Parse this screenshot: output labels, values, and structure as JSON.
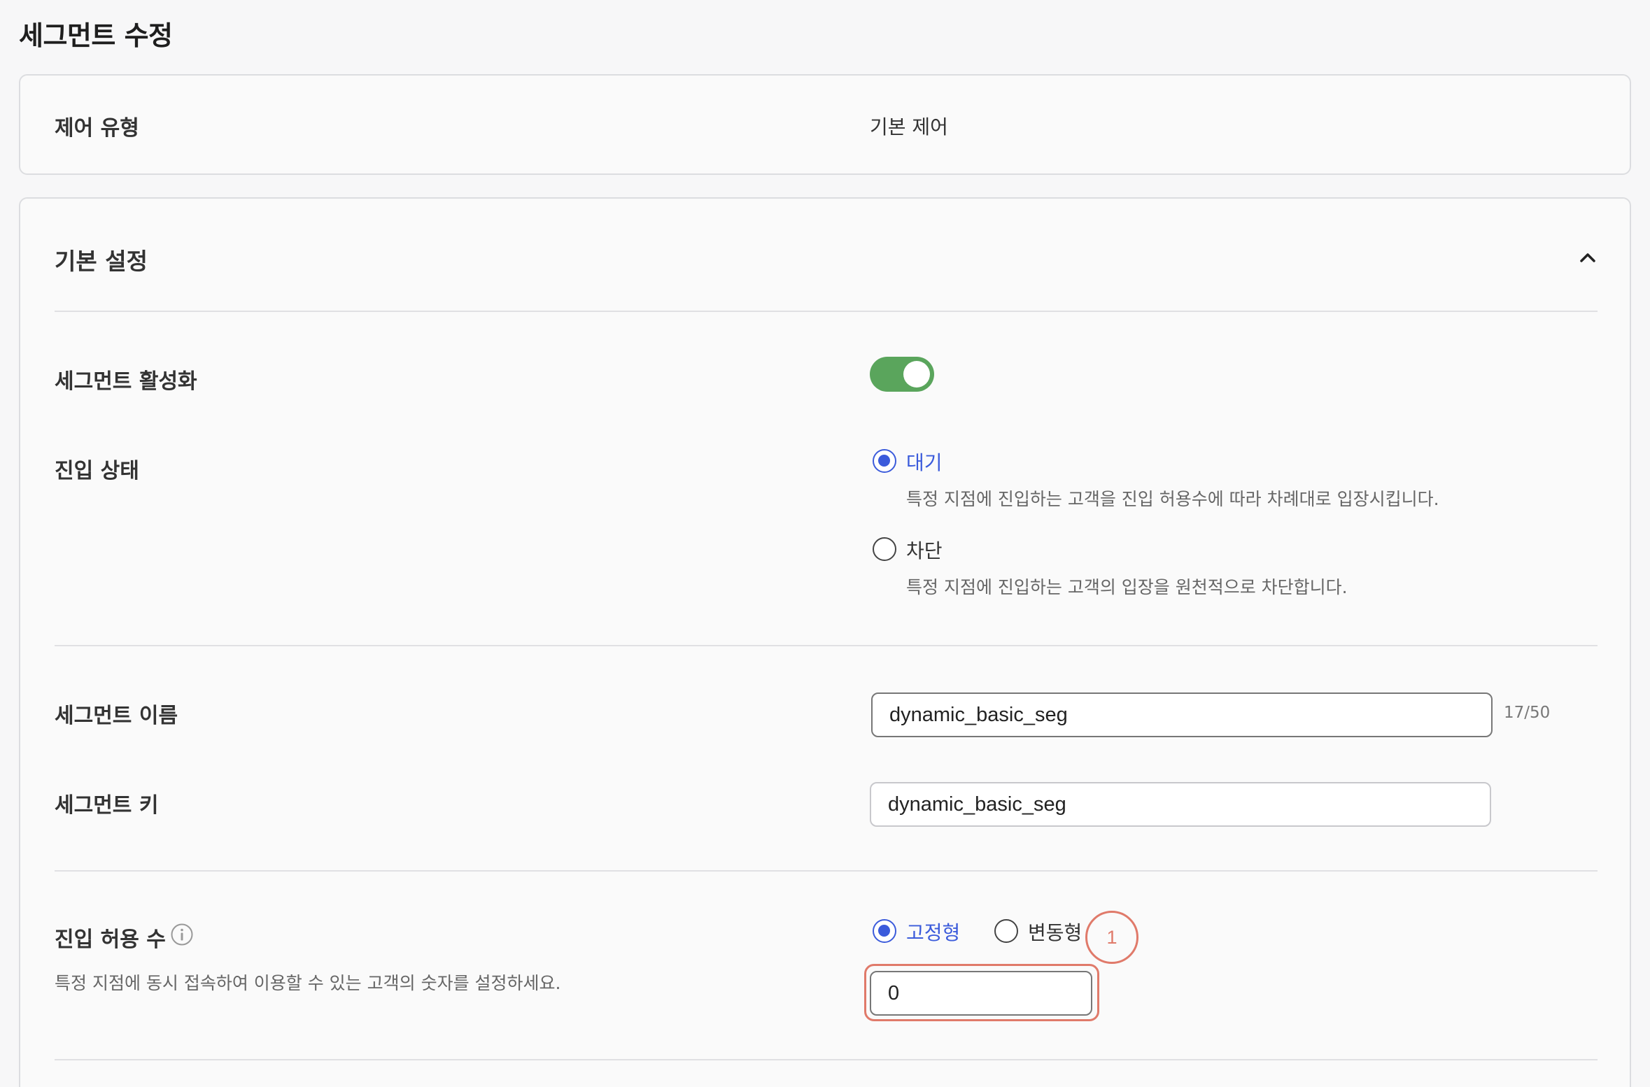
{
  "page": {
    "title": "세그먼트 수정"
  },
  "control_type": {
    "label": "제어 유형",
    "value": "기본 제어"
  },
  "basic_settings": {
    "title": "기본 설정",
    "collapse_icon": "chevron-up-icon",
    "activation": {
      "label": "세그먼트 활성화",
      "enabled": true,
      "accent_color": "#5aa55c"
    },
    "entry_status": {
      "label": "진입 상태",
      "options": [
        {
          "label": "대기",
          "desc": "특정 지점에 진입하는 고객을 진입 허용수에 따라 차례대로 입장시킵니다.",
          "selected": true
        },
        {
          "label": "차단",
          "desc": "특정 지점에 진입하는 고객의 입장을 원천적으로 차단합니다.",
          "selected": false
        }
      ]
    },
    "segment_name": {
      "label": "세그먼트 이름",
      "value": "dynamic_basic_seg",
      "counter": "17/50"
    },
    "segment_key": {
      "label": "세그먼트 키",
      "value": "dynamic_basic_seg"
    },
    "entry_limit": {
      "label": "진입 허용 수",
      "info_icon": "info-icon",
      "helper": "특정 지점에 동시 접속하여 이용할 수 있는 고객의 숫자를 설정하세요.",
      "modes": [
        {
          "label": "고정형",
          "selected": true
        },
        {
          "label": "변동형",
          "selected": false
        }
      ],
      "value": "0"
    }
  },
  "annotation": {
    "badge": "1",
    "color": "#e07a6a"
  },
  "theme": {
    "primary": "#3b5bdb"
  }
}
